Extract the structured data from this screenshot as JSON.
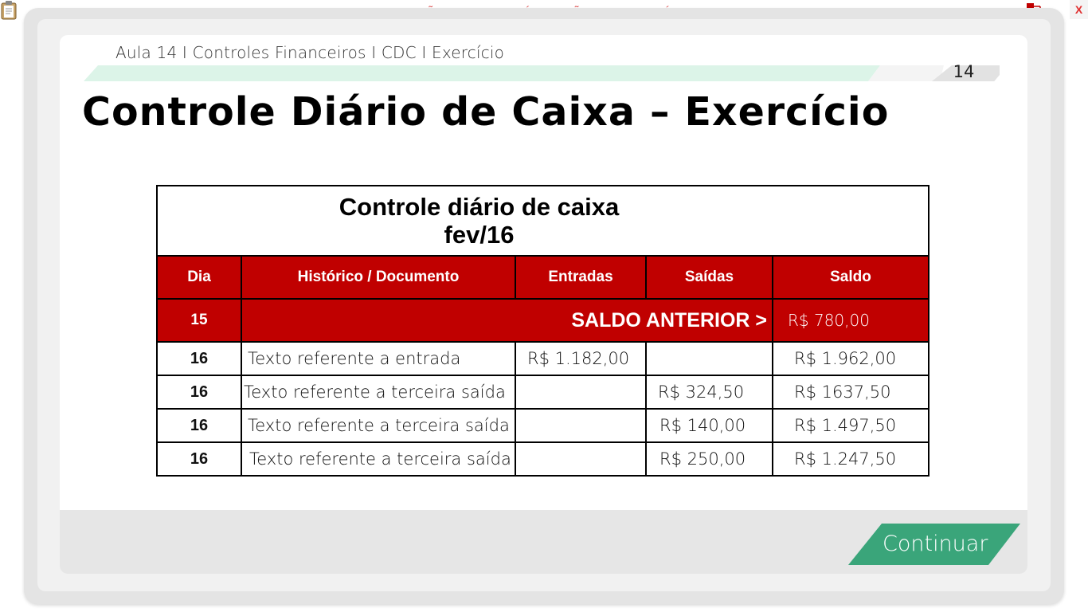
{
  "banner": "VERSÃO PARA FUNCIONÁRIOS - NÃO COMERCIALIZÁVEL",
  "icons": {
    "clipboard": "clipboard-icon",
    "network": "network-icon",
    "close": "close-icon"
  },
  "close_label": "X",
  "breadcrumb": "Aula 14 I Controles Financeiros I CDC I Exercício",
  "page_number": "14",
  "title": "Controle Diário de Caixa – Exercício",
  "table": {
    "title_line1": "Controle diário de caixa",
    "title_line2": "fev/16",
    "headers": [
      "Dia",
      "Histórico / Documento",
      "Entradas",
      "Saídas",
      "Saldo"
    ],
    "previous_balance": {
      "day": "15",
      "label": "SALDO ANTERIOR >",
      "value": "R$ 780,00"
    },
    "rows": [
      {
        "day": "16",
        "description": "Texto referente a entrada",
        "entradas": "R$ 1.182,00",
        "saidas": "",
        "saldo": "R$ 1.962,00"
      },
      {
        "day": "16",
        "description": "Texto referente a terceira saída",
        "entradas": "",
        "saidas": "R$ 324,50",
        "saldo": "R$ 1637,50"
      },
      {
        "day": "16",
        "description": "Texto referente a terceira saída",
        "entradas": "",
        "saidas": "R$ 140,00",
        "saldo": "R$ 1.497,50"
      },
      {
        "day": "16",
        "description": "Texto referente a terceira saída",
        "entradas": "",
        "saidas": "R$ 250,00",
        "saldo": "R$ 1.247,50"
      }
    ]
  },
  "continue_label": "Continuar",
  "colors": {
    "table_red": "#c00000",
    "accent_green": "#3aa57a",
    "stripe_mint": "#d9f3e6"
  }
}
